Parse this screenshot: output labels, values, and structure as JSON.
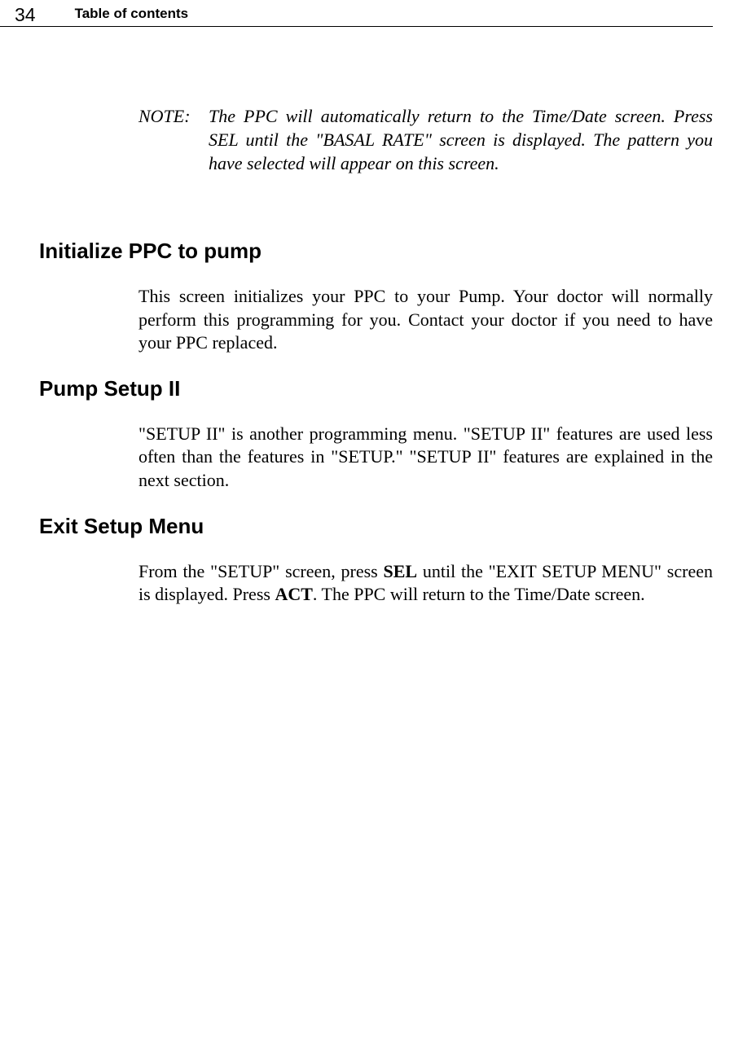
{
  "header": {
    "page_number": "34",
    "title": "Table of contents"
  },
  "note": {
    "label": "NOTE:",
    "text": "The PPC will automatically return to the Time/Date screen. Press SEL until the \"BASAL RATE\" screen is displayed. The pattern you have selected will appear on this screen."
  },
  "sections": {
    "initialize": {
      "heading": "Initialize PPC to pump",
      "para": "This screen initializes your PPC to your Pump. Your doctor will normally perform this programming for you. Contact your doctor if you need to have your PPC replaced."
    },
    "setup2": {
      "heading": "Pump Setup II",
      "para": "\"SETUP II\" is another programming menu. \"SETUP II\" features are used less often than the features in \"SETUP.\" \"SETUP II\" features are explained in the next section."
    },
    "exit": {
      "heading": "Exit Setup Menu",
      "para_pre": "From the \"SETUP\" screen, press ",
      "sel": "SEL",
      "para_mid": " until the \"EXIT SETUP MENU\" screen is displayed. Press ",
      "act": "ACT",
      "para_post": ". The PPC will return to the Time/Date screen."
    }
  }
}
